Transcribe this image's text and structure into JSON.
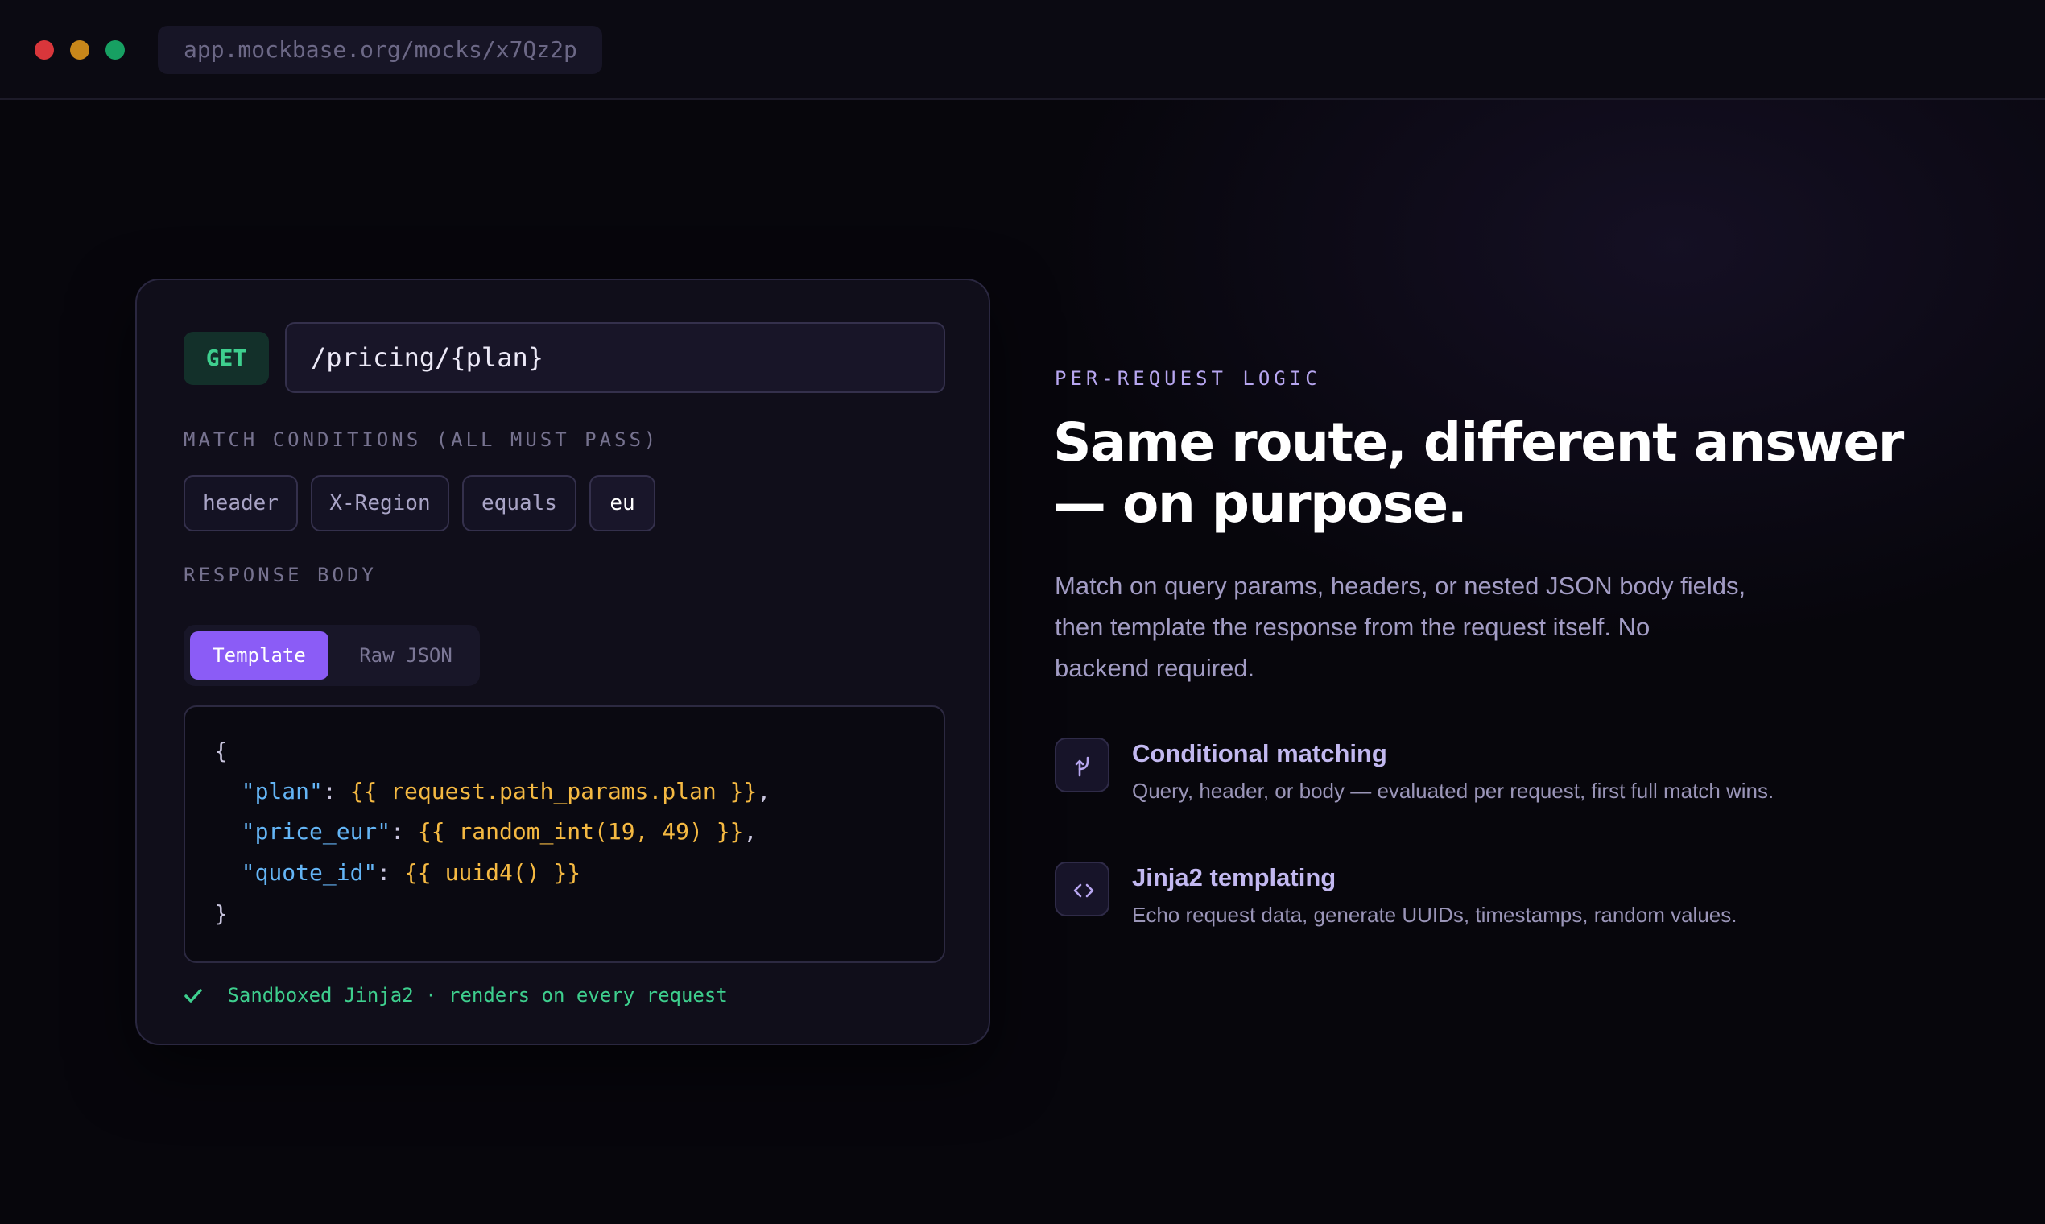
{
  "browser": {
    "url": "app.mockbase.org/mocks/x7Qz2p"
  },
  "editor": {
    "method": "GET",
    "path": "/pricing/{plan}",
    "match_label": "MATCH CONDITIONS (ALL MUST PASS)",
    "conditions": [
      "header",
      "X-Region",
      "equals",
      "eu"
    ],
    "response_label": "RESPONSE BODY",
    "tabs": [
      "Template",
      "Raw JSON"
    ],
    "active_tab": "Template",
    "code": {
      "open": "{",
      "lines": [
        {
          "key": "\"plan\"",
          "value": "{{ request.path_params.plan }}",
          "trail": ","
        },
        {
          "key": "\"price_eur\"",
          "value": "{{ random_int(19, 49) }}",
          "trail": ","
        },
        {
          "key": "\"quote_id\"",
          "value": "{{ uuid4() }}",
          "trail": ""
        }
      ],
      "close": "}"
    },
    "note": "Sandboxed Jinja2 · renders on every request"
  },
  "hero": {
    "eyebrow": "PER-REQUEST LOGIC",
    "headline_line1": "Same route, different answer",
    "headline_line2": "— on purpose.",
    "lead": "Match on query params, headers, or nested JSON body fields, then template the response from the request itself. No backend required."
  },
  "features": [
    {
      "icon": "branch-icon",
      "title": "Conditional matching",
      "desc": "Query, header, or body — evaluated per request, first full match wins."
    },
    {
      "icon": "code-icon",
      "title": "Jinja2 templating",
      "desc": "Echo request data, generate UUIDs, timestamps, random values."
    }
  ],
  "colors": {
    "accent": "#8b5cf6",
    "success": "#3ecf8e",
    "template": "#f5b942",
    "json_key": "#64b5f6"
  }
}
